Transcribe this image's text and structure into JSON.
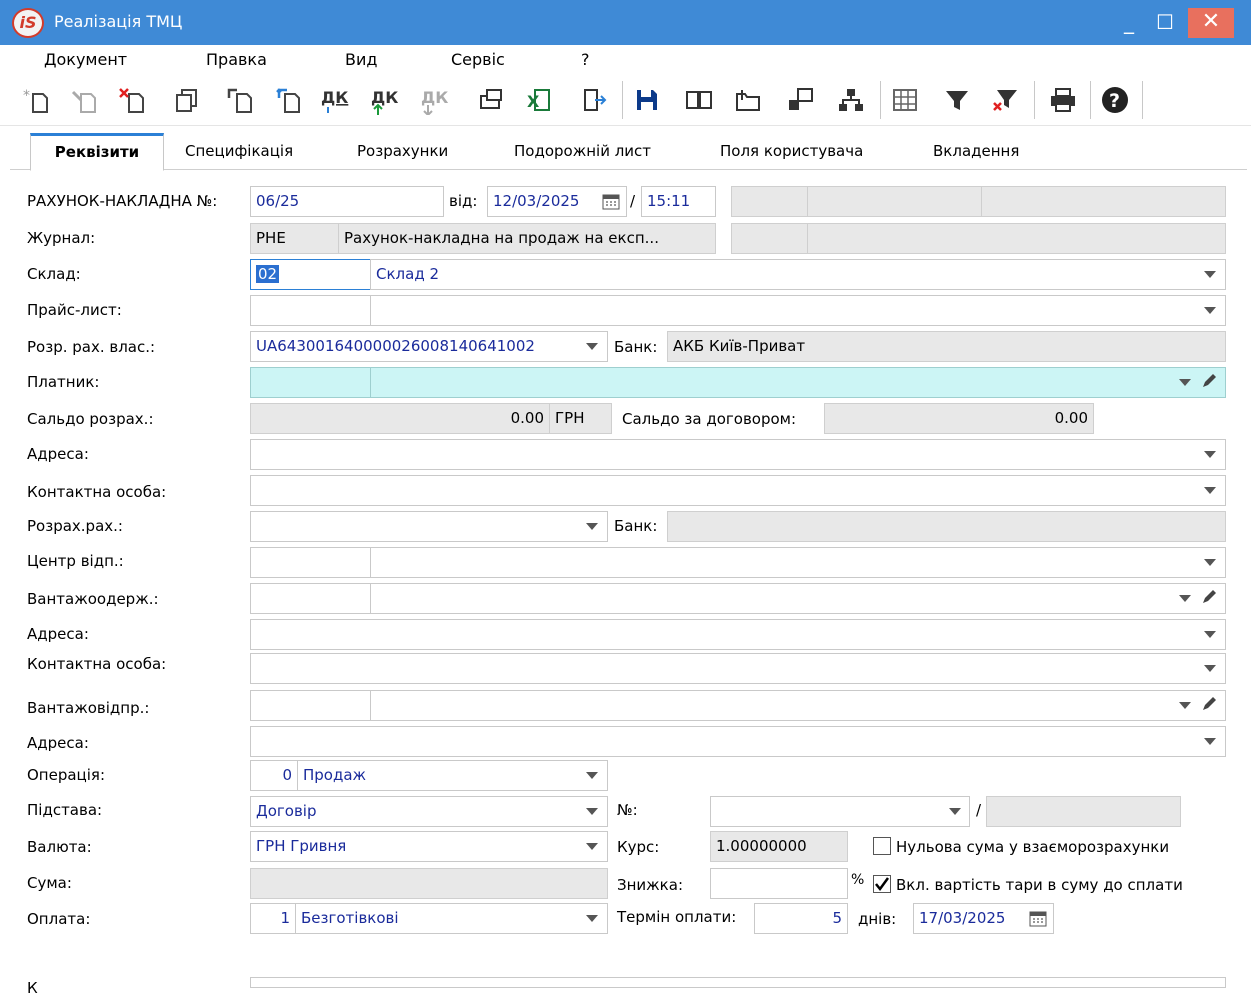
{
  "window": {
    "title": "Реалізація ТМЦ",
    "logo_text": "iS",
    "minimize": "_",
    "maximize": "☐",
    "close": "✕"
  },
  "menu": [
    "Документ",
    "Правка",
    "Вид",
    "Сервіс",
    "?"
  ],
  "toolbar": {
    "ledger_label": "ДК"
  },
  "tabs": [
    "Реквізити",
    "Специфікація",
    "Розрахунки",
    "Подорожній лист",
    "Поля користувача",
    "Вкладення"
  ],
  "form": {
    "invoice": {
      "label": "РАХУНОК-НАКЛАДНА №:",
      "number": "06/25",
      "from_label": "від:",
      "date": "12/03/2025",
      "slash": "/",
      "time": "15:11"
    },
    "journal": {
      "label": "Журнал:",
      "code": "РНЕ",
      "name": "Рахунок-накладна на продаж на експ..."
    },
    "warehouse": {
      "label": "Склад:",
      "code": "02",
      "name": "Склад 2"
    },
    "price_list": {
      "label": "Прайс-лист:"
    },
    "own_account": {
      "label": "Розр. рах. влас.:",
      "value": "UA643001640000026008140641002",
      "bank_label": "Банк:",
      "bank_value": "АКБ Київ-Приват"
    },
    "payer": {
      "label": "Платник:"
    },
    "balance": {
      "label": "Сальдо розрах.:",
      "value": "0.00",
      "currency": "ГРН",
      "contract_label": "Сальдо за договором:",
      "contract_value": "0.00"
    },
    "address1": {
      "label": "Адреса:"
    },
    "contact1": {
      "label": "Контактна особа:"
    },
    "settle_account": {
      "label": "Розрах.рах.:",
      "bank_label": "Банк:"
    },
    "responsibility_center": {
      "label": "Центр відп.:"
    },
    "consignee": {
      "label": "Вантажоодерж.:"
    },
    "address2": {
      "label": "Адреса:"
    },
    "contact2": {
      "label": "Контактна особа:"
    },
    "shipper": {
      "label": "Вантажовідпр.:"
    },
    "address3": {
      "label": "Адреса:"
    },
    "operation": {
      "label": "Операція:",
      "code": "0",
      "name": "Продаж"
    },
    "basis": {
      "label": "Підстава:",
      "value": "Договір",
      "number_label": "№:",
      "slash": "/"
    },
    "currency": {
      "label": "Валюта:",
      "value": "ГРН Гривня",
      "rate_label": "Курс:",
      "rate_value": "1.00000000",
      "zero_sum_label": "Нульова сума у взаєморозрахунки"
    },
    "sum": {
      "label": "Сума:",
      "discount_label": "Знижка:",
      "percent": "%",
      "tare_label": "Вкл. вартість тари в суму до сплати"
    },
    "payment": {
      "label": "Оплата:",
      "code": "1",
      "name": "Безготівкові",
      "term_label": "Термін оплати:",
      "term_value": "5",
      "days_label": "днів:",
      "due_date": "17/03/2025"
    },
    "comment": {
      "label": "К"
    }
  },
  "colors": {
    "titlebar": "#3f8ad6",
    "close": "#e8705e",
    "tab_accent": "#2b80d6",
    "cyan_field": "#ccf5f5",
    "value_text": "#1a2b9b",
    "gray_field": "#e8e8e8"
  }
}
